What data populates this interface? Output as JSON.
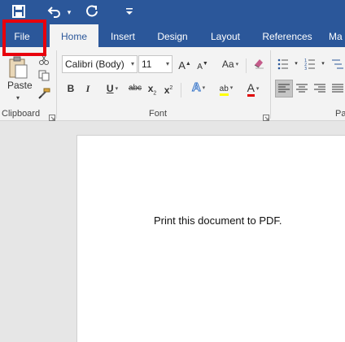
{
  "quick_access": {
    "save": "save-icon",
    "undo": "undo-icon",
    "undo_dropdown": "▾",
    "redo": "redo-icon",
    "customize": "customize-icon"
  },
  "tabs": [
    {
      "label": "File"
    },
    {
      "label": "Home"
    },
    {
      "label": "Insert"
    },
    {
      "label": "Design"
    },
    {
      "label": "Layout"
    },
    {
      "label": "References"
    },
    {
      "label": "Ma"
    }
  ],
  "clipboard": {
    "paste_label": "Paste",
    "group_label": "Clipboard"
  },
  "font": {
    "font_name": "Calibri (Body)",
    "font_size": "11",
    "grow": "A",
    "shrink": "A",
    "change_case": "Aa",
    "bold": "B",
    "italic": "I",
    "underline": "U",
    "strikethrough": "abc",
    "subscript": "x",
    "superscript": "x",
    "sub_mark": "2",
    "sup_mark": "2",
    "text_effects": "A",
    "highlight": "ab",
    "font_color": "A",
    "group_label": "Font"
  },
  "paragraph": {
    "group_label": "Pa"
  },
  "colors": {
    "accent": "#2b579a",
    "highlight_marker": "#ffff00",
    "font_color_bar": "#e00000",
    "file_outline": "#e8000c"
  },
  "document": {
    "text": "Print this document to PDF."
  }
}
